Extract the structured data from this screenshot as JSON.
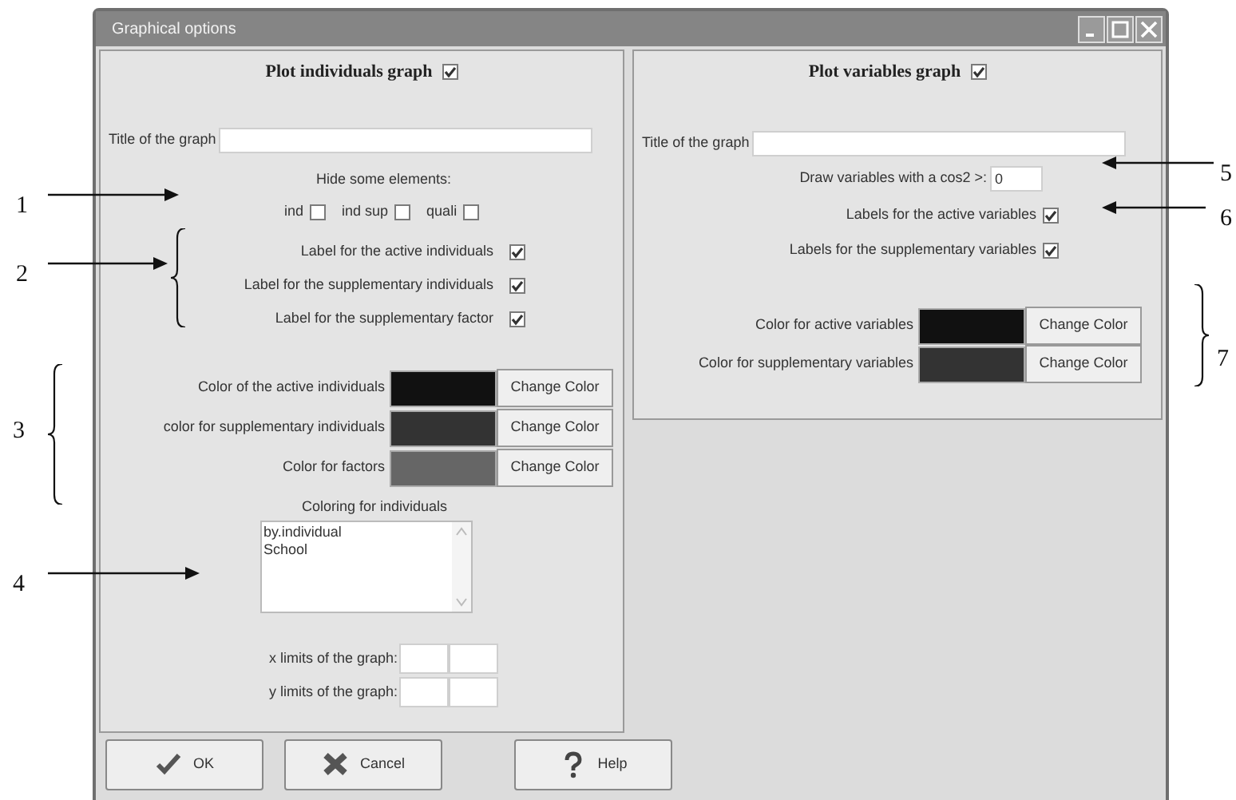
{
  "window": {
    "title": "Graphical options"
  },
  "left_panel": {
    "heading": "Plot individuals graph",
    "heading_checked": true,
    "title_label": "Title of the graph",
    "hide_label": "Hide some elements:",
    "hide_options": [
      {
        "label": "ind",
        "checked": false
      },
      {
        "label": "ind sup",
        "checked": false
      },
      {
        "label": "quali",
        "checked": false
      }
    ],
    "label_options": [
      {
        "label": "Label for the active individuals",
        "checked": true
      },
      {
        "label": "Label for the supplementary individuals",
        "checked": true
      },
      {
        "label": "Label for the supplementary factor",
        "checked": true
      }
    ],
    "colors": [
      {
        "label": "Color of the active individuals",
        "color": "#111111",
        "button": "Change Color"
      },
      {
        "label": "color for supplementary individuals",
        "color": "#333333",
        "button": "Change Color"
      },
      {
        "label": "Color for factors",
        "color": "#666666",
        "button": "Change Color"
      }
    ],
    "coloring_label": "Coloring for individuals",
    "coloring_items": [
      {
        "label": "by.individual",
        "selected": false
      },
      {
        "label": "School",
        "selected": false
      }
    ],
    "limits": [
      {
        "label": "x limits of the graph:"
      },
      {
        "label": "y limits of the graph:"
      }
    ]
  },
  "right_panel": {
    "heading": "Plot variables graph",
    "heading_checked": true,
    "title_label": "Title of the graph",
    "cos2": {
      "label": "Draw variables with a cos2 >:",
      "value": "0"
    },
    "label_options": [
      {
        "label": "Labels for the active variables",
        "checked": true
      },
      {
        "label": "Labels for the supplementary variables",
        "checked": true
      }
    ],
    "colors": [
      {
        "label": "Color for active variables",
        "color": "#111111",
        "button": "Change Color"
      },
      {
        "label": "Color for supplementary variables",
        "color": "#333333",
        "button": "Change Color"
      }
    ]
  },
  "buttons": [
    {
      "label": "OK",
      "kind": "ok"
    },
    {
      "label": "Cancel",
      "kind": "cancel"
    },
    {
      "label": "Help",
      "kind": "help"
    }
  ],
  "annotations": [
    {
      "label": "1",
      "kind": "arrow"
    },
    {
      "label": "2",
      "kind": "arrow-brace"
    },
    {
      "label": "3",
      "kind": "brace"
    },
    {
      "label": "4",
      "kind": "arrow"
    },
    {
      "label": "5",
      "kind": "arrow"
    },
    {
      "label": "6",
      "kind": "arrow"
    },
    {
      "label": "7",
      "kind": "brace"
    }
  ]
}
